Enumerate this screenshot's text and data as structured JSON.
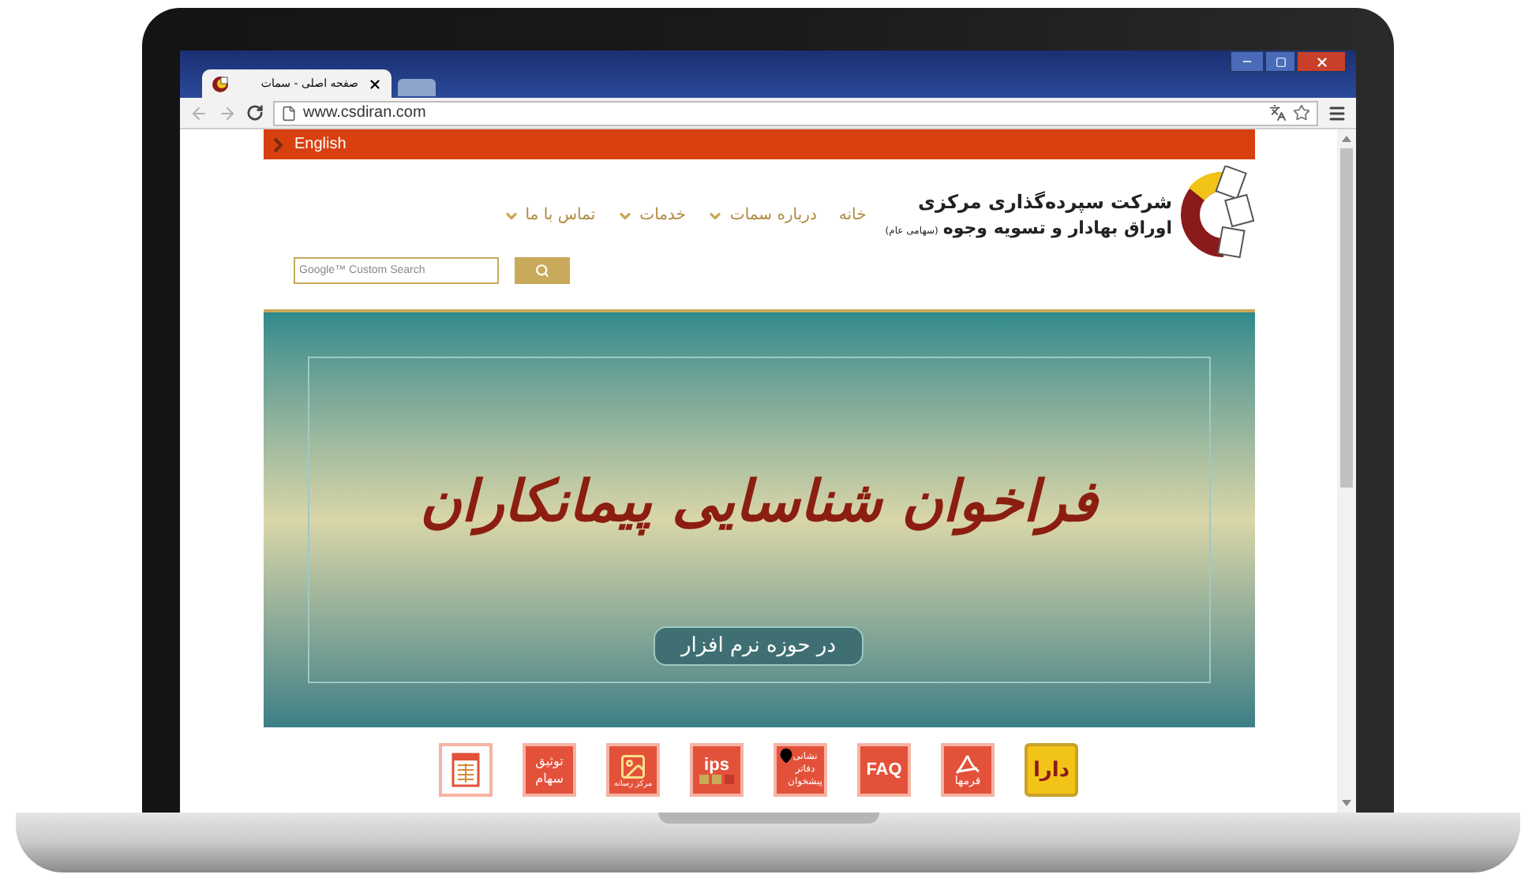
{
  "browser": {
    "tab_title": "صفحه اصلی - سمات",
    "url": "www.csdiran.com"
  },
  "top_bar": {
    "link": "English"
  },
  "logo": {
    "line_1": "شرکت سپرده‌گذاری مرکزی",
    "line_2": "اوراق بهادار و تسویه وجوه",
    "line_2_suffix": "(سهامی عام)"
  },
  "nav": [
    {
      "label": "خانه",
      "dropdown": false
    },
    {
      "label": "درباره سمات",
      "dropdown": true
    },
    {
      "label": "خدمات",
      "dropdown": true
    },
    {
      "label": "تماس با ما",
      "dropdown": true
    }
  ],
  "search": {
    "placeholder": "Google™ Custom Search"
  },
  "banner": {
    "title": "فراخوان شناسایی پیمانکاران",
    "subtitle": "در حوزه نرم افزار"
  },
  "quick_links": [
    {
      "kind": "brand",
      "label": "دارا"
    },
    {
      "kind": "pdf",
      "label": "فرمها"
    },
    {
      "kind": "faq",
      "label": "FAQ"
    },
    {
      "kind": "pin",
      "label": "نشانی دفاتر پیشخوان"
    },
    {
      "kind": "ips",
      "label": "ips"
    },
    {
      "kind": "media",
      "label": "مرکز رسانه"
    },
    {
      "kind": "text",
      "label": "توثیق سهام"
    },
    {
      "kind": "sheet"
    }
  ]
}
